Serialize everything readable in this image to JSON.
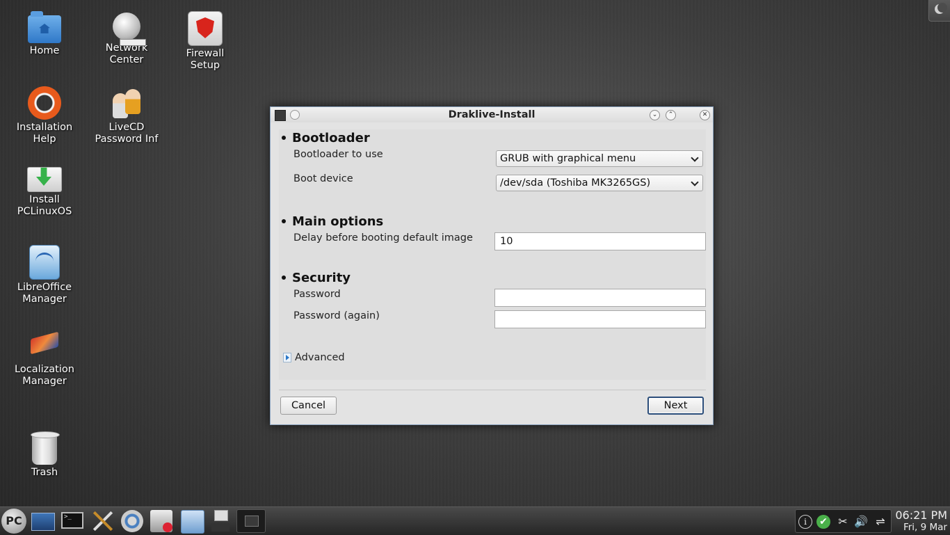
{
  "desktop": {
    "icons": [
      {
        "label": "Home",
        "icon": "home-folder-icon"
      },
      {
        "label": "Network\nCenter",
        "icon": "network-center-icon"
      },
      {
        "label": "Firewall\nSetup",
        "icon": "firewall-shield-icon"
      },
      {
        "label": "Installation\nHelp",
        "icon": "lifebuoy-icon"
      },
      {
        "label": "LiveCD\nPassword Inf",
        "icon": "users-icon"
      },
      {
        "label": "Install\nPCLinuxOS",
        "icon": "install-drive-icon"
      },
      {
        "label": "LibreOffice\nManager",
        "icon": "libreoffice-icon"
      },
      {
        "label": "Localization\nManager",
        "icon": "localization-icon"
      },
      {
        "label": "Trash",
        "icon": "trash-icon"
      }
    ]
  },
  "dialog": {
    "title": "Draklive-Install",
    "sections": {
      "bootloader": {
        "heading": "Bootloader",
        "bootloader_label": "Bootloader to use",
        "bootloader_value": "GRUB with graphical menu",
        "device_label": "Boot device",
        "device_value": "/dev/sda (Toshiba MK3265GS)"
      },
      "main_options": {
        "heading": "Main options",
        "delay_label": "Delay before booting default image",
        "delay_value": "10"
      },
      "security": {
        "heading": "Security",
        "password_label": "Password",
        "password_value": "",
        "password_again_label": "Password (again)",
        "password_again_value": ""
      }
    },
    "advanced_label": "Advanced",
    "cancel_label": "Cancel",
    "next_label": "Next"
  },
  "taskbar": {
    "menu_label": "PC",
    "launchers": [
      "show-desktop-icon",
      "terminal-icon",
      "tools-icon",
      "control-center-icon",
      "package-manager-icon",
      "file-manager-icon",
      "desktop-pager-icon"
    ],
    "terminal_glyph": ">_",
    "tray": {
      "info_glyph": "i",
      "check_glyph": "✔",
      "clip_glyph": "✂",
      "volume_glyph": "🔊",
      "network_glyph": "⇌"
    },
    "clock": {
      "time": "06:21 PM",
      "date": "Fri, 9 Mar"
    }
  }
}
